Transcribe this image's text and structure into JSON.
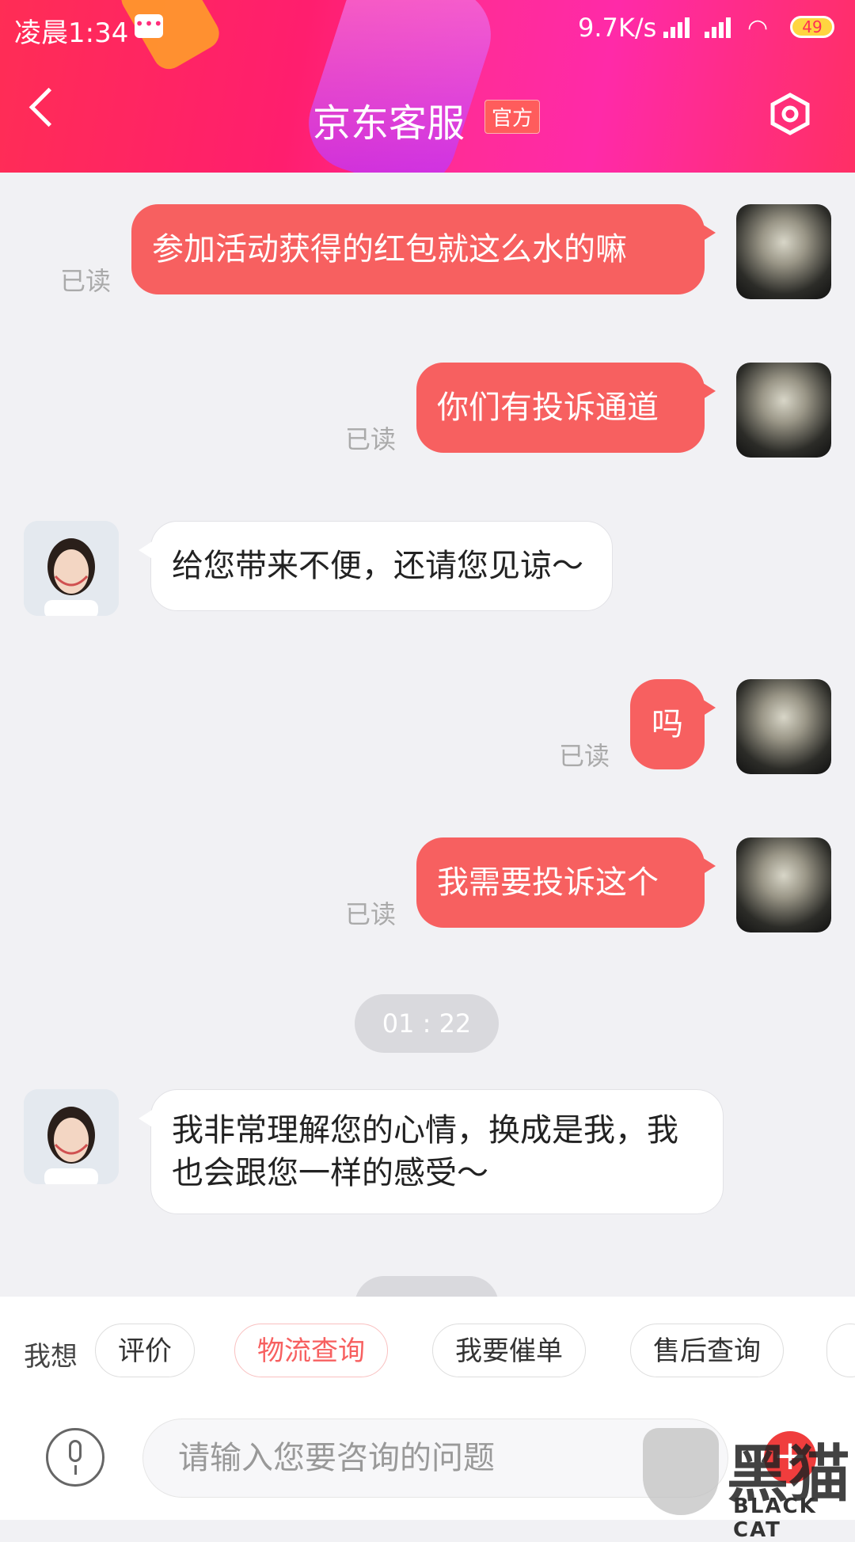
{
  "status_bar": {
    "time": "凌晨1:34",
    "speed": "9.7K/s",
    "battery": "49"
  },
  "header": {
    "title": "京东客服",
    "badge": "官方"
  },
  "messages": [
    {
      "side": "out",
      "text": "参加活动获得的红包就这么水的嘛",
      "status": "已读"
    },
    {
      "side": "out",
      "text": "你们有投诉通道",
      "status": "已读"
    },
    {
      "side": "in",
      "text": "给您带来不便，还请您见谅～"
    },
    {
      "side": "out",
      "text": "吗",
      "status": "已读"
    },
    {
      "side": "out",
      "text": "我需要投诉这个",
      "status": "已读"
    },
    {
      "side": "time",
      "text": "01 : 22"
    },
    {
      "side": "in",
      "text_line1": "我非常理解您的心情，换成是我，我",
      "text_line2": "也会跟您一样的感受～"
    }
  ],
  "quick_bar": {
    "label": "我想",
    "chips": [
      "评价",
      "物流查询",
      "我要催单",
      "售后查询"
    ]
  },
  "input": {
    "placeholder": "请输入您要咨询的问题"
  },
  "watermark": {
    "cn": "黑猫",
    "en": "BLACK CAT"
  }
}
